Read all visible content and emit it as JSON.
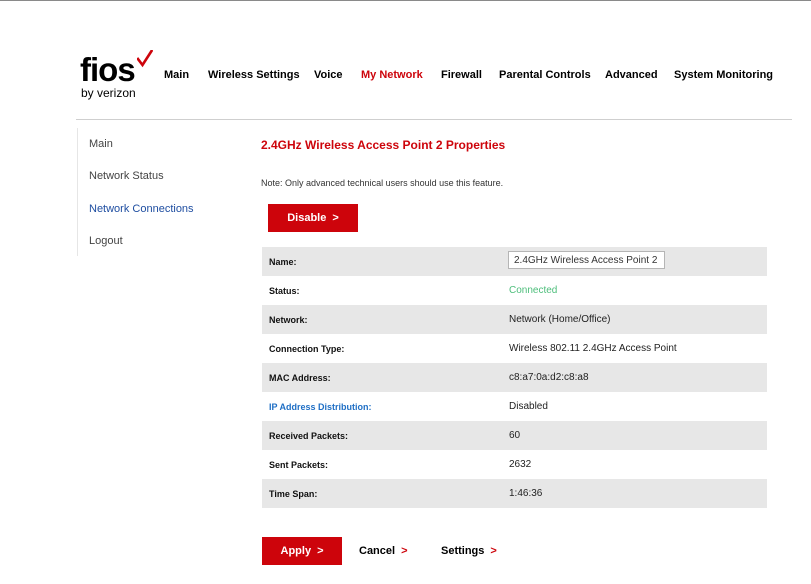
{
  "brand": {
    "name": "fios",
    "tagline": "by verizon",
    "accent_color": "#cd040b"
  },
  "topnav": [
    {
      "label": "Main",
      "active": false
    },
    {
      "label": "Wireless Settings",
      "active": false
    },
    {
      "label": "Voice",
      "active": false
    },
    {
      "label": "My Network",
      "active": true
    },
    {
      "label": "Firewall",
      "active": false
    },
    {
      "label": "Parental Controls",
      "active": false
    },
    {
      "label": "Advanced",
      "active": false
    },
    {
      "label": "System Monitoring",
      "active": false
    }
  ],
  "sidebar": [
    {
      "label": "Main",
      "active": false
    },
    {
      "label": "Network Status",
      "active": false
    },
    {
      "label": "Network Connections",
      "active": true
    },
    {
      "label": "Logout",
      "active": false
    }
  ],
  "page": {
    "title": "2.4GHz Wireless Access Point 2 Properties",
    "note": "Note: Only advanced technical users should use this feature.",
    "disable_label": "Disable"
  },
  "properties": [
    {
      "label": "Name:",
      "value": "2.4GHz Wireless Access Point 2"
    },
    {
      "label": "Status:",
      "value": "Connected"
    },
    {
      "label": "Network:",
      "value": "Network (Home/Office)"
    },
    {
      "label": "Connection Type:",
      "value": "Wireless 802.11 2.4GHz Access Point"
    },
    {
      "label": "MAC Address:",
      "value": "c8:a7:0a:d2:c8:a8"
    },
    {
      "label": "IP Address Distribution:",
      "value": "Disabled"
    },
    {
      "label": "Received Packets:",
      "value": "60"
    },
    {
      "label": "Sent Packets:",
      "value": "2632"
    },
    {
      "label": "Time Span:",
      "value": "1:46:36"
    }
  ],
  "actions": {
    "apply_label": "Apply",
    "cancel_label": "Cancel",
    "settings_label": "Settings"
  },
  "colors": {
    "status_connected": "#4dbe7b",
    "link_blue": "#1f6fc5",
    "active_sidebar": "#1f4ea1"
  },
  "icons": {
    "brand_mark": "check-icon",
    "button_arrow": "chevron-right-icon"
  }
}
